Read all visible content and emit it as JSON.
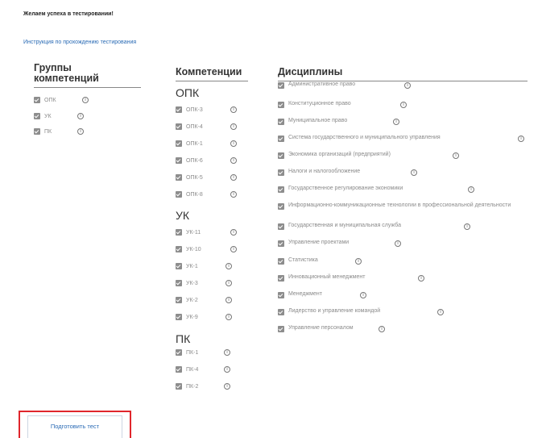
{
  "greeting": "Желаем успеха в тестировании!",
  "instruction_link": "Инструкция по прохождению тестирования",
  "info_glyph": "i",
  "columns": {
    "groups": {
      "title_line1": "Группы",
      "title_line2": "компетенций",
      "items": [
        {
          "label": "ОПК",
          "checked": true
        },
        {
          "label": "УК",
          "checked": true
        },
        {
          "label": "ПК",
          "checked": true
        }
      ]
    },
    "competencies": {
      "title": "Компетенции",
      "sections": [
        {
          "name": "ОПК",
          "items": [
            "ОПК-3",
            "ОПК-4",
            "ОПК-1",
            "ОПК-6",
            "ОПК-5",
            "ОПК-8"
          ]
        },
        {
          "name": "УК",
          "items": [
            "УК-11",
            "УК-10",
            "УК-1",
            "УК-3",
            "УК-2",
            "УК-9"
          ]
        },
        {
          "name": "ПК",
          "items": [
            "ПК-1",
            "ПК-4",
            "ПК-2"
          ]
        }
      ]
    },
    "disciplines": {
      "title": "Дисциплины",
      "items": [
        "Административное право",
        "Конституционное право",
        "Муниципальное право",
        "Система государственного и муниципального управления",
        "Экономика организаций (предприятий)",
        "Налоги и налогообложение",
        "Государственное регулирование экономики",
        "Информационно-коммуникационные технологии в профессиональной деятельности",
        "Государственная и муниципальная служба",
        "Управление проектами",
        "Статистика",
        "Инновационный менеджмент",
        "Менеджмент",
        "Лидерство и управление командой",
        "Управление персоналом"
      ]
    }
  },
  "prepare_button": "Подготовить тест",
  "colors": {
    "link": "#2a6bb5",
    "checkbox": "#8d8d8d",
    "highlight_frame": "#e0262c"
  }
}
